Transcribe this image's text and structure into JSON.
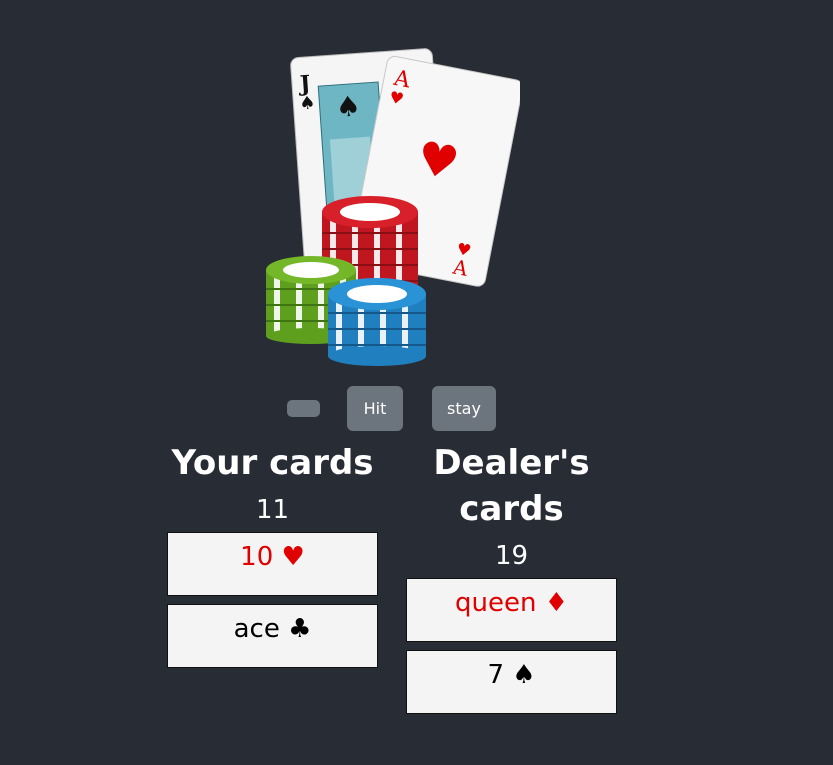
{
  "controls": {
    "empty_label": "",
    "hit_label": "Hit",
    "stay_label": "stay"
  },
  "player": {
    "heading": "Your cards",
    "total": "11",
    "cards": [
      {
        "text": "10 ♥",
        "color": "#e00000"
      },
      {
        "text": "ace ♣",
        "color": "#000000"
      }
    ]
  },
  "dealer": {
    "heading": "Dealer's cards",
    "total": "19",
    "cards": [
      {
        "text": "queen ♦",
        "color": "#e00000"
      },
      {
        "text": "7 ♠",
        "color": "#000000"
      }
    ]
  },
  "hero_image": {
    "icon": "playing-cards-and-chips-illustration"
  },
  "colors": {
    "background": "#282c34",
    "button": "#6c757d",
    "card": "#f4f4f4"
  }
}
